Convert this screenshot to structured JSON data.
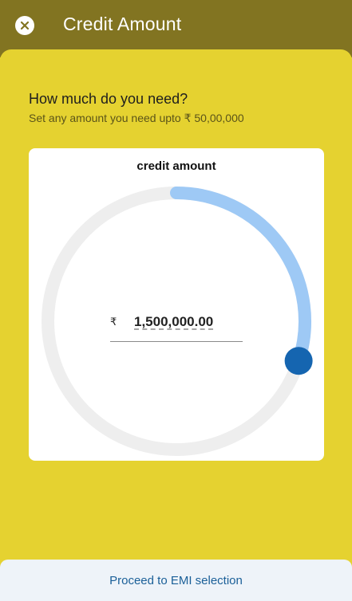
{
  "header": {
    "title": "Credit Amount",
    "close_icon": "close-icon"
  },
  "prompt": {
    "question": "How much do you need?",
    "subtext": "Set any amount you need upto ₹ 50,00,000"
  },
  "card": {
    "title": "credit amount",
    "currency_symbol": "₹",
    "amount_value": "1,500,000.00",
    "max_amount": 5000000,
    "current_amount": 1500000,
    "progress_fraction": 0.3
  },
  "footer": {
    "proceed_label": "Proceed to EMI selection"
  },
  "colors": {
    "app_bar": "#827421",
    "background": "#e5d230",
    "track": "#eeeeee",
    "progress": "#9ec9f5",
    "knob": "#1565b0",
    "link": "#1a5f98"
  }
}
